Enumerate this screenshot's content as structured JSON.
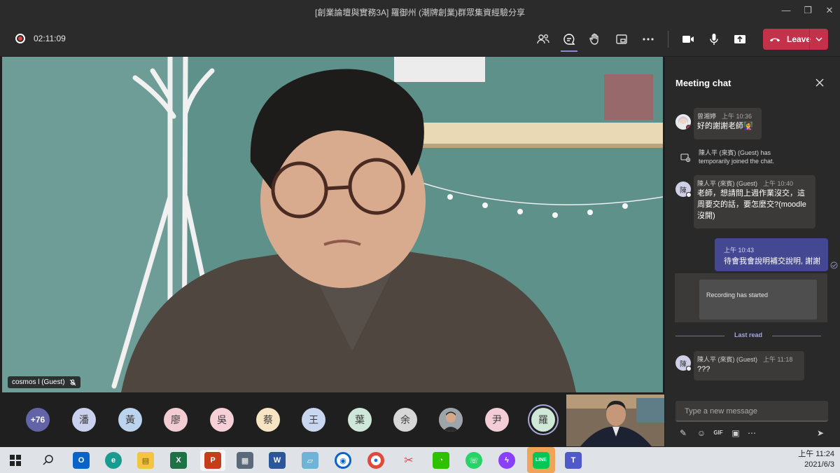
{
  "window": {
    "title": "[創業論壇與實務3A] 羅御州 (潮牌創業)群眾集資經驗分享"
  },
  "controls": {
    "timer": "02:11:09",
    "leave_label": "Leave"
  },
  "video": {
    "main_participant_label": "cosmos l (Guest)"
  },
  "participants": [
    {
      "label": "+76",
      "color": "#6264a7"
    },
    {
      "label": "潘",
      "color": "#c9d1ec"
    },
    {
      "label": "黃",
      "color": "#bcd3ee"
    },
    {
      "label": "廖",
      "color": "#f2ccd2"
    },
    {
      "label": "吳",
      "color": "#f7cfd6"
    },
    {
      "label": "蔡",
      "color": "#f7e4c2"
    },
    {
      "label": "王",
      "color": "#c9d6ef"
    },
    {
      "label": "葉",
      "color": "#cfe7da"
    },
    {
      "label": "余",
      "color": "#d7d7d7"
    },
    {
      "label": "",
      "color": "#c2a48a"
    },
    {
      "label": "尹",
      "color": "#f2cdd7"
    },
    {
      "label": "羅",
      "color": "#cfe9d9"
    }
  ],
  "chat": {
    "title": "Meeting chat",
    "messages": [
      {
        "sender": "曾湘婷",
        "time": "上午 10:36",
        "text": "好的謝謝老師👩‍🏫"
      },
      {
        "sender": "陳人平 (來賓) (Guest)",
        "time": "上午 10:40",
        "text_line1": "老師，想請問上週作業沒交，這",
        "text_line2": "周要交的話，要怎麼交?(moodle",
        "text_line3": "沒開)",
        "avatar": "陳"
      },
      {
        "sender": "陳人平 (來賓) (Guest)",
        "time": "上午 11:18",
        "text": "???",
        "avatar": "陳"
      }
    ],
    "system_line1": "陳人平 (來賓) (Guest) has",
    "system_line2": "temporarily joined the chat.",
    "my_message": {
      "time": "上午 10:43",
      "text": "待會我會說明補交說明, 謝謝"
    },
    "recording_notice": "Recording has started",
    "last_read": "Last read",
    "compose_placeholder": "Type a new message"
  },
  "taskbar": {
    "time": "上午 11:24",
    "date": "2021/6/3"
  }
}
